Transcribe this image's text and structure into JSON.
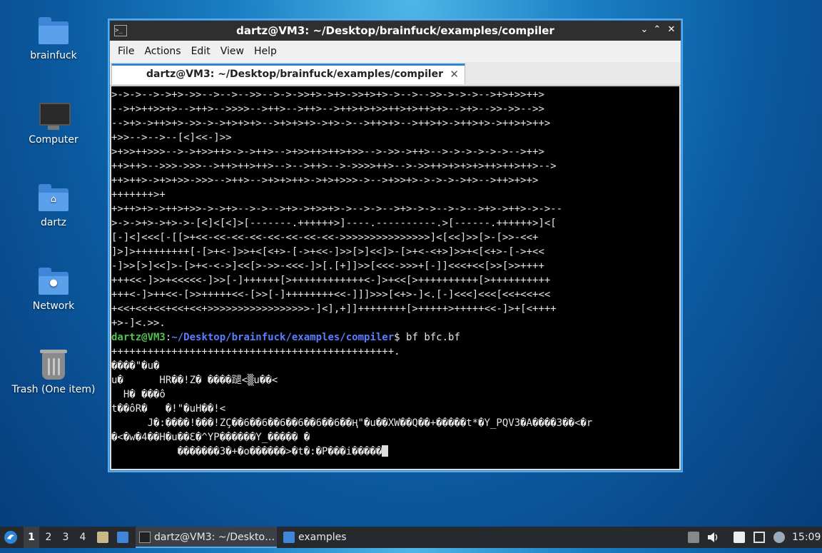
{
  "desktop": {
    "icons": [
      {
        "label": "brainfuck",
        "icon": "folder-icon"
      },
      {
        "label": "Computer",
        "icon": "computer-icon"
      },
      {
        "label": "dartz",
        "icon": "home-folder-icon"
      },
      {
        "label": "Network",
        "icon": "network-folder-icon"
      },
      {
        "label": "Trash (One item)",
        "icon": "trash-icon"
      }
    ]
  },
  "window": {
    "title": "dartz@VM3: ~/Desktop/brainfuck/examples/compiler",
    "menu": [
      "File",
      "Actions",
      "Edit",
      "View",
      "Help"
    ],
    "tab_label": "dartz@VM3: ~/Desktop/brainfuck/examples/compiler",
    "tab_close": "✕",
    "controls": {
      "minimize": "⌄",
      "maximize": "⌃",
      "close": "✕"
    }
  },
  "terminal": {
    "output_before": [
      ">->->-->->+>->>-->-->-->>-->->->>+>->+>->>+>+>->-->-->>->->->-->+>+>>++>",
      "-->+>++>>+>-->++>-->>>>-->++>-->++>-->++>+>+>>++>+>++>+>-->+>-->>->>-->>",
      "-->+>->++>+>->>->->+>+>+>-->+>+>+>->+>->-->++>+>-->++>+>->++>+>->++>+>++>",
      "+>>-->-->--[<]<<-]>>",
      ">+>>++>>>-->->+>>++>->->++>-->+>>++>++>+>>-->->>->++>-->->->->->->-->++>",
      "++>++>-->>>->>>-->++>++>++>-->-->++>-->->>>>++>-->->>++>+>+>+>++>++>++>-->",
      "++>++>->+>+>>->>>-->++>-->+>+>++>->+>+>>>->-->+>>+>->->->->+>-->++>+>+>",
      "+++++++>+",
      "+>++>+>->++>+>>->->+>-->->-->+>->+>>+>->-->->-->+>->->-->->-->+>->++>->->--",
      ">->->+>->+>->-[<]<[<]>[-------.++++++>]----.----------.>[------.++++++>]<[",
      "[-]<]<<<[-[[>+<<-<<-<<-<<-<<-<<-<<-<<->>>>>>>>>>>>>>>]<[<<]>>[>-[>>-<<+",
      "]>]>+++++++++[-[>+<-]>>+<[<+>-[->+<<-]>>[>]<<]>-[>+<-<+>]>>+<[<+>-[->+<<",
      "-]>>[>]<<]>-[>+<-<->]<<[>->>-<<<-]>[.[+]]>>[<<<->>>+[-]]<<<+<<[>>[>>++++",
      "+++<<-]>>+<<<<<-]>>[-]++++++[>++++++++++++<-]>+<<[>++++++++++[>++++++++++",
      "+++<-]>++<<-[>>+++++<<-[>>[-]++++++++<<-]]]>>>[<+>-]<.[-]<<<]<<<[<<+<<+<<",
      "+<<+<<+<<+<<+<<+>>>>>>>>>>>>>>>>>-]<],+]]++++++++[>+++++>+++++<<-]>+[<++++",
      "+>-]<.>>."
    ],
    "prompt_user": "dartz@VM3",
    "prompt_sep": ":",
    "prompt_path": "~/Desktop/brainfuck/examples/compiler",
    "prompt_end": "$ bf bfc.bf",
    "output_after": [
      "+++++++++++++++++++++++++++++++++++++++++++++++.",
      "����\"�u�",
      "u�      HR��!Z� ����蹆<▒u��<",
      "  H� ���ô",
      "t��ôR�   �!\"�uH��!<",
      "      J�:����!���!ZÇ��6��6��6��6��6��6��Ⱨ\"�u��XW��Q��+�����t*�Y_PQV3�A����3��<�r",
      "�<�w�4��H�u��Ɛ�^YP������Y_����� �",
      "           �������3�+�o������>�t�:�P���i�����"
    ]
  },
  "taskbar": {
    "workspaces": [
      "1",
      "2",
      "3",
      "4"
    ],
    "tasks": [
      {
        "label": "dartz@VM3: ~/Deskto…",
        "icon": "terminal-icon"
      },
      {
        "label": "examples",
        "icon": "folder-icon"
      }
    ],
    "clock": "15:09"
  }
}
